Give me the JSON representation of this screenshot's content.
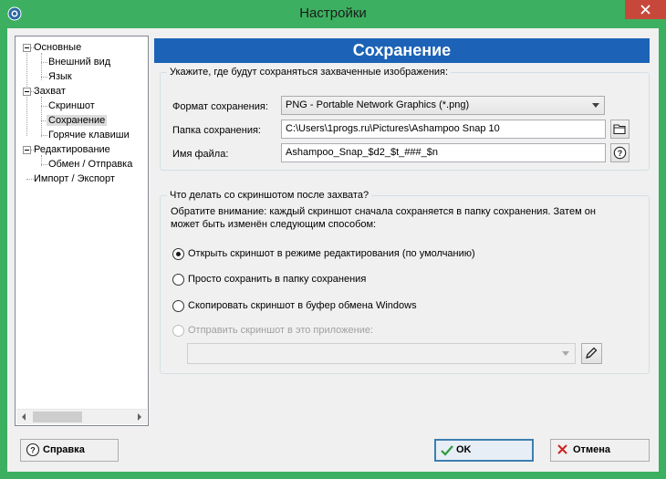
{
  "window": {
    "title": "Настройки",
    "accent": "#3cb060",
    "header_color": "#1c63b7"
  },
  "tree": {
    "items": [
      {
        "label": "Основные"
      },
      {
        "label": "Внешний вид"
      },
      {
        "label": "Язык"
      },
      {
        "label": "Захват"
      },
      {
        "label": "Скриншот"
      },
      {
        "label": "Сохранение",
        "selected": true
      },
      {
        "label": "Горячие клавиши"
      },
      {
        "label": "Редактирование"
      },
      {
        "label": "Обмен / Отправка"
      },
      {
        "label": "Импорт / Экспорт"
      }
    ]
  },
  "header": {
    "title": "Сохранение"
  },
  "save_group": {
    "title": "Укажите, где будут сохраняться захваченные изображения:",
    "format_label": "Формат сохранения:",
    "format_value": "PNG - Portable Network Graphics (*.png)",
    "folder_label": "Папка сохранения:",
    "folder_value": "C:\\Users\\1progs.ru\\Pictures\\Ashampoo Snap 10",
    "filename_label": "Имя файла:",
    "filename_value": "Ashampoo_Snap_$d2_$t_###_$n"
  },
  "after_group": {
    "title": "Что делать со скриншотом после захвата?",
    "note_line1": "Обратите внимание: каждый скриншот сначала сохраняется в папку сохранения. Затем он",
    "note_line2": "может быть изменён следующим способом:",
    "options": [
      {
        "label": "Открыть скриншот в режиме редактирования (по умолчанию)",
        "checked": true
      },
      {
        "label": "Просто сохранить в папку сохранения",
        "checked": false
      },
      {
        "label": "Скопировать скриншот в буфер обмена Windows",
        "checked": false
      },
      {
        "label": "Отправить скриншот в это приложение:",
        "checked": false,
        "disabled": true
      }
    ],
    "app_value": ""
  },
  "buttons": {
    "help": "Справка",
    "ok": "OK",
    "cancel": "Отмена"
  }
}
